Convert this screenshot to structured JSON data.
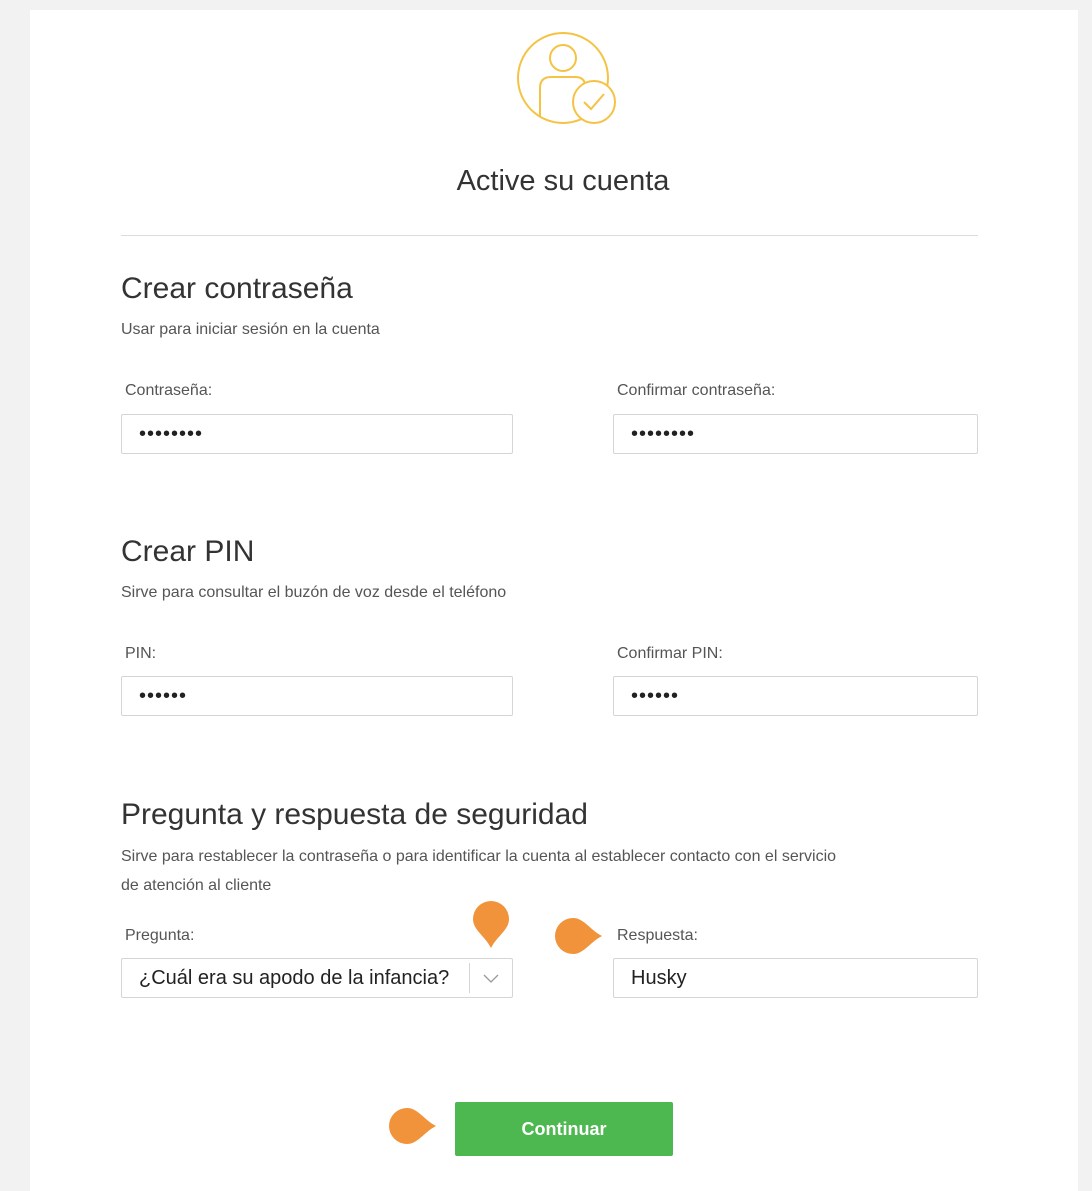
{
  "header": {
    "title": "Active su cuenta",
    "icon": "user-check-icon"
  },
  "password_section": {
    "title": "Crear contraseña",
    "description": "Usar para iniciar sesión en la cuenta",
    "password_label": "Contraseña:",
    "password_value": "••••••••",
    "confirm_label": "Confirmar contraseña:",
    "confirm_value": "••••••••"
  },
  "pin_section": {
    "title": "Crear PIN",
    "description": "Sirve para consultar el buzón de voz desde el teléfono",
    "pin_label": "PIN:",
    "pin_value": "••••••",
    "confirm_label": "Confirmar PIN:",
    "confirm_value": "••••••"
  },
  "security_section": {
    "title": "Pregunta y respuesta de seguridad",
    "description_line1": "Sirve para restablecer la contraseña o para identificar la cuenta al establecer contacto con el servicio",
    "description_line2": "de atención al cliente",
    "question_label": "Pregunta:",
    "question_value": "¿Cuál era su apodo de la infancia?",
    "answer_label": "Respuesta:",
    "answer_value": "Husky"
  },
  "footer": {
    "continue_label": "Continuar"
  },
  "colors": {
    "accent_orange": "#f0933a",
    "button_green": "#4db84f",
    "icon_yellow": "#f5c244"
  }
}
